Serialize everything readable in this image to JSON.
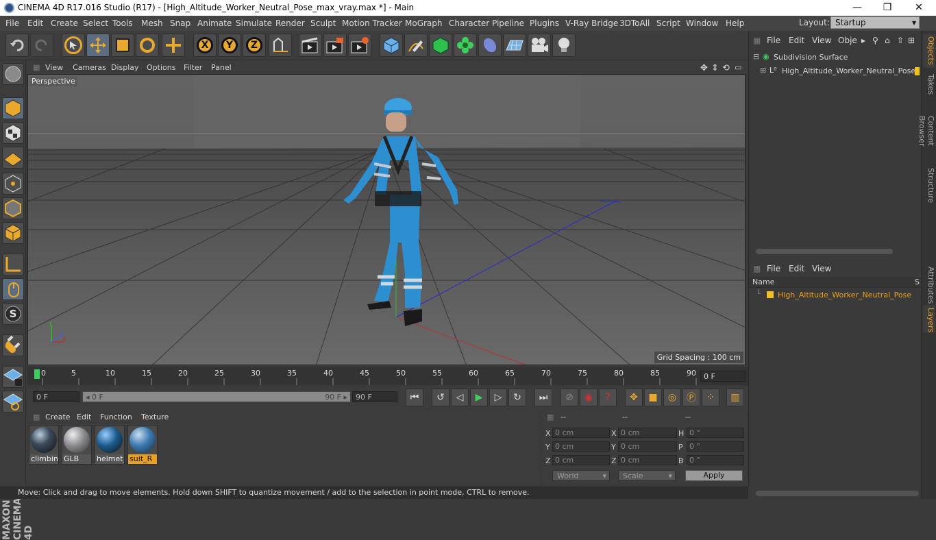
{
  "window": {
    "title": "CINEMA 4D R17.016 Studio (R17) - [High_Altitude_Worker_Neutral_Pose_max_vray.max *] - Main",
    "minimize": "—",
    "maximize": "❐",
    "close": "✕"
  },
  "menu": [
    "File",
    "Edit",
    "Create",
    "Select",
    "Tools",
    "Mesh",
    "Snap",
    "Animate",
    "Simulate",
    "Render",
    "Sculpt",
    "Motion Tracker",
    "MoGraph",
    "Character",
    "Pipeline",
    "Plugins",
    "V-Ray Bridge",
    "3DToAll",
    "Script",
    "Window",
    "Help"
  ],
  "layout": {
    "label": "Layout:",
    "value": "Startup"
  },
  "toolbar": {
    "x_axis": "X",
    "y_axis": "Y",
    "z_axis": "Z"
  },
  "viewport": {
    "menu": [
      "View",
      "Cameras",
      "Display",
      "Options",
      "Filter",
      "Panel"
    ],
    "label": "Perspective",
    "grid_spacing": "Grid Spacing : 100 cm",
    "axis_x": "X",
    "axis_y": "Y",
    "axis_z": "Z"
  },
  "timeline": {
    "ticks": [
      "0",
      "5",
      "10",
      "15",
      "20",
      "25",
      "30",
      "35",
      "40",
      "45",
      "50",
      "55",
      "60",
      "65",
      "70",
      "75",
      "80",
      "85",
      "90"
    ],
    "current_frame": "0 F"
  },
  "transport": {
    "start_frame": "0 F",
    "slider_start": "◂ 0 F",
    "slider_end": "90 F ▸",
    "end_frame": "90 F"
  },
  "materials": {
    "menu": [
      "Create",
      "Edit",
      "Function",
      "Texture"
    ],
    "items": [
      {
        "label": "climbing",
        "color": "#3a4a5a"
      },
      {
        "label": "GLB",
        "color": "#8a8a90"
      },
      {
        "label": "helmet_",
        "color": "#1a5a8a"
      },
      {
        "label": "suit_R",
        "color": "#3a7ab0"
      }
    ]
  },
  "coords": {
    "headers": [
      "--",
      "--",
      "--"
    ],
    "labels": [
      "X",
      "Y",
      "Z",
      "X",
      "Y",
      "Z",
      "H",
      "P",
      "B"
    ],
    "pos": [
      "0 cm",
      "0 cm",
      "0 cm"
    ],
    "size": [
      "0 cm",
      "0 cm",
      "0 cm"
    ],
    "rot": [
      "0 °",
      "0 °",
      "0 °"
    ],
    "mode1": "World",
    "mode2": "Scale",
    "apply": "Apply"
  },
  "status": "Move: Click and drag to move elements. Hold down SHIFT to quantize movement / add to the selection in point mode, CTRL to remove.",
  "objects": {
    "menu": [
      "File",
      "Edit",
      "View",
      "Obje"
    ],
    "items": [
      "Subdivision Surface",
      "High_Altitude_Worker_Neutral_Pose"
    ]
  },
  "layers": {
    "menu": [
      "File",
      "Edit",
      "View"
    ],
    "col_name": "Name",
    "col_s": "S",
    "item": "High_Altitude_Worker_Neutral_Pose"
  },
  "right_tabs": [
    "Objects",
    "Takes",
    "Content Browser",
    "Structure",
    "Attributes",
    "Layers"
  ],
  "brand": "MAXON CINEMA 4D"
}
